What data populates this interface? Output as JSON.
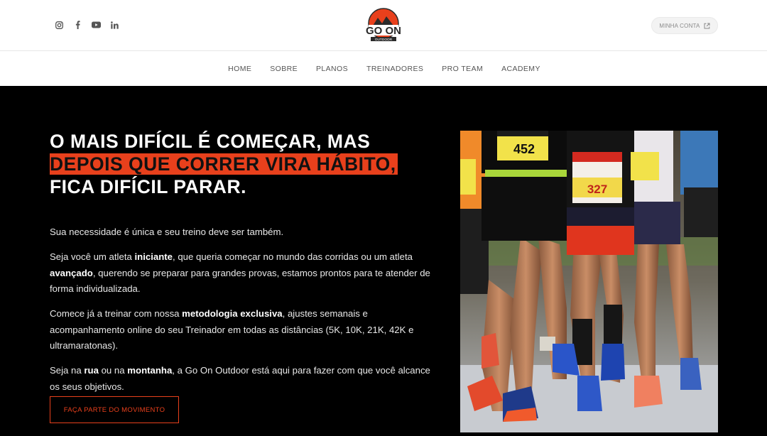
{
  "header": {
    "social": [
      {
        "name": "instagram-icon"
      },
      {
        "name": "facebook-icon"
      },
      {
        "name": "youtube-icon"
      },
      {
        "name": "linkedin-icon"
      }
    ],
    "logo_text": "GO ON",
    "logo_sub": "OUTDOOR",
    "account_label": "MINHA CONTA"
  },
  "nav": {
    "items": [
      "HOME",
      "SOBRE",
      "PLANOS",
      "TREINADORES",
      "PRO TEAM",
      "ACADEMY"
    ]
  },
  "hero": {
    "headline_line1": "O MAIS DIFÍCIL É COMEÇAR, MAS",
    "headline_line2": "DEPOIS QUE CORRER VIRA HÁBITO,",
    "headline_line3": "FICA DIFÍCIL PARAR.",
    "p1": "Sua necessidade é única e seu treino deve ser também.",
    "p2_a": "Seja você um atleta ",
    "p2_b": "iniciante",
    "p2_c": ", que queria começar no mundo das corridas ou um atleta ",
    "p2_d": "avançado",
    "p2_e": ", querendo se preparar para grandes provas, estamos prontos para te atender de forma individualizada.",
    "p3_a": "Comece já a treinar com nossa ",
    "p3_b": "metodologia exclusiva",
    "p3_c": ", ajustes semanais e acompanhamento online do seu Treinador em todas as distâncias (5K, 10K, 21K, 42K e ultramaratonas).",
    "p4_a": "Seja na ",
    "p4_b": "rua",
    "p4_c": " ou na ",
    "p4_d": "montanha",
    "p4_e": ", a Go On Outdoor está aqui para fazer com que você alcance os seus objetivos.",
    "cta_label": "FAÇA PARTE DO MOVIMENTO",
    "bib1": "452",
    "bib2": "327"
  },
  "colors": {
    "accent": "#e8401c",
    "background": "#000000",
    "header_bg": "#ffffff"
  }
}
